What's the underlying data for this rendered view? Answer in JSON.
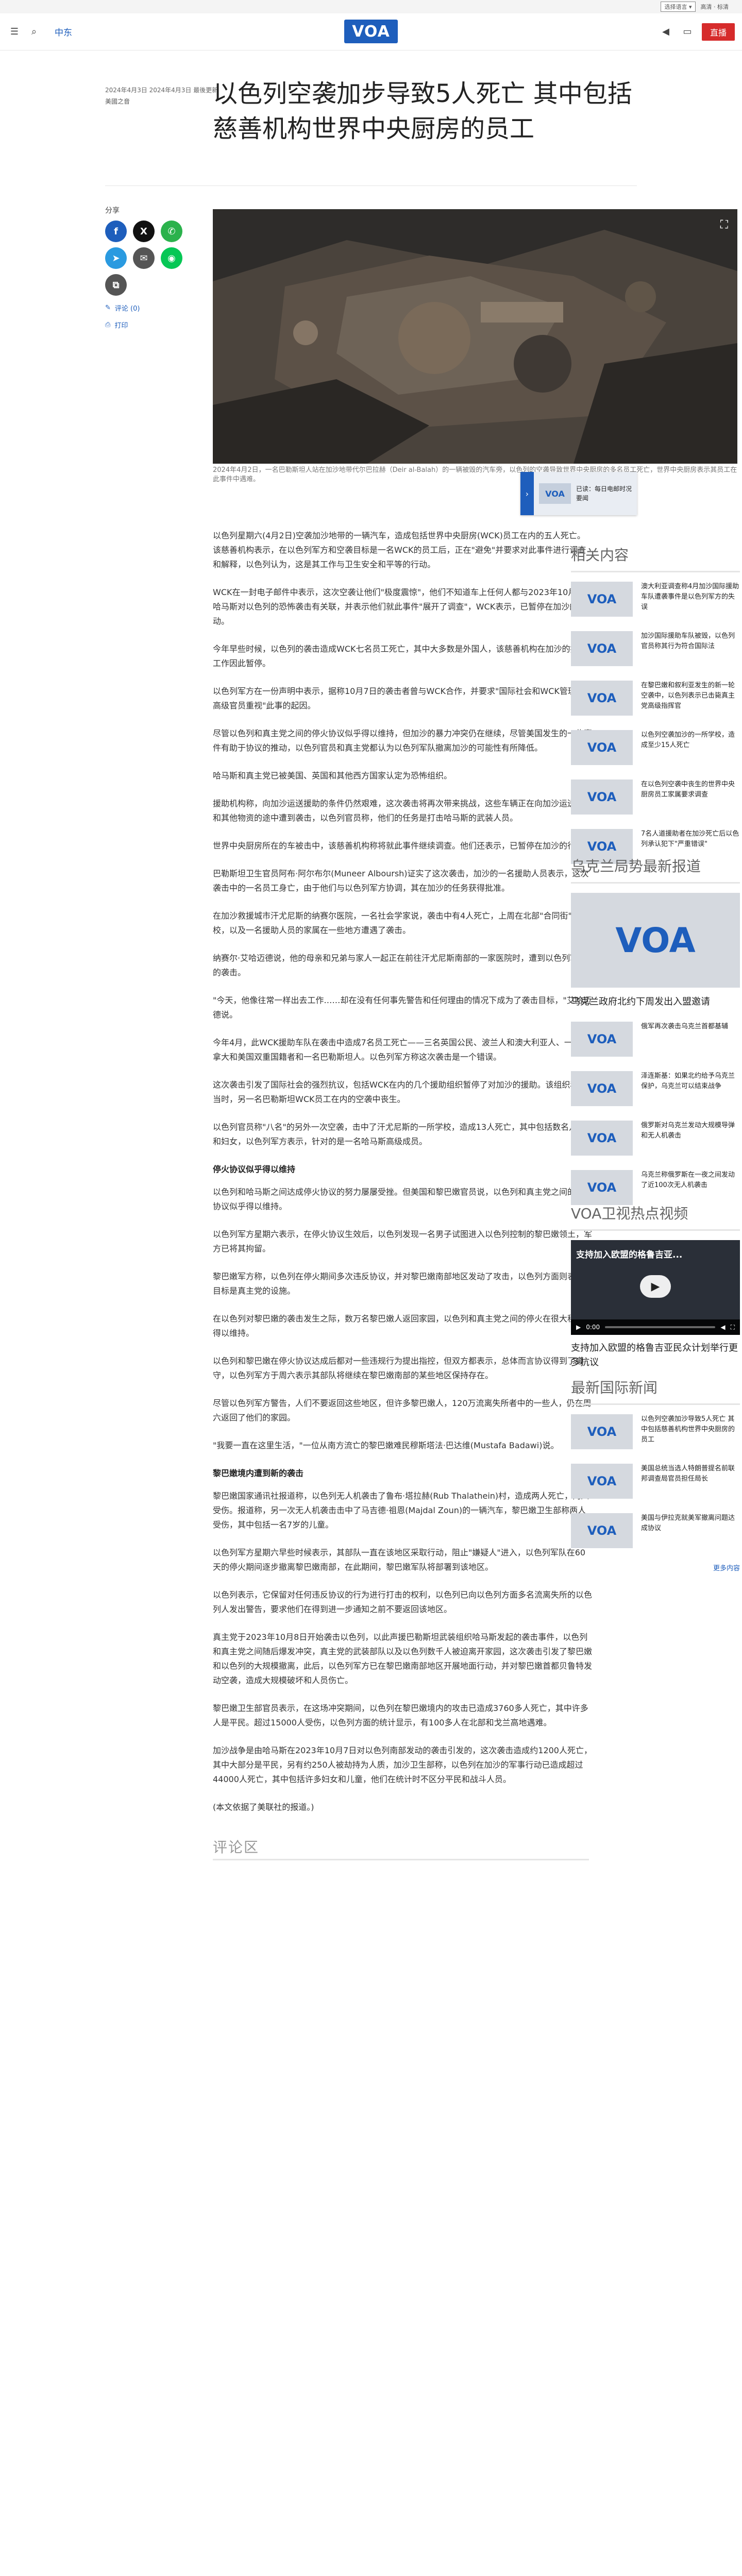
{
  "topbar": {
    "lang_select": "选择语言 ▾",
    "hd": "高清 · 标清"
  },
  "header": {
    "section": "中东",
    "logo": "VOA",
    "live": "直播"
  },
  "meta": {
    "dates": "2024年4月3日 2024年4月3日 最後更新",
    "source": "美國之音"
  },
  "title": "以色列空袭加步导致5人死亡 其中包括慈善机构世界中央厨房的员工",
  "share": {
    "label": "分享",
    "comments": "评论 (0)",
    "print": "打印"
  },
  "hero": {
    "caption": "2024年4月2日，一名巴勒斯坦人站在加沙地带代尔巴拉赫（Deir al-Balah）的一辆被毁的汽车旁，以色列的空袭导致世界中央厨房的多名员工死亡，世界中央厨房表示其员工在此事件中遇难。"
  },
  "floatcard": {
    "text": "已读：每日电邮时况要闻"
  },
  "article": [
    {
      "type": "p",
      "text": "以色列星期六(4月2日)空袭加沙地带的一辆汽车，造成包括世界中央厨房(WCK)员工在内的五人死亡。该慈善机构表示，在以色列军方和空袭目标是一名WCK的员工后，正在\"避免\"并要求对此事件进行调查和解释，以色列认为，这是其工作与卫生安全和平等的行动。"
    },
    {
      "type": "p",
      "text": "WCK在一封电子邮件中表示，这次空袭让他们\"极度震惊\"，他们不知道车上任何人都与2023年10月7日哈马斯对以色列的恐怖袭击有关联，并表示他们就此事件\"展开了调查\"，WCK表示，已暂停在加沙的行动。"
    },
    {
      "type": "p",
      "text": "今年早些时候，以色列的袭击造成WCK七名员工死亡，其中大多数是外国人，该慈善机构在加沙的援助工作因此暂停。"
    },
    {
      "type": "p",
      "text": "以色列军方在一份声明中表示，据称10月7日的袭击者曾与WCK合作，并要求\"国际社会和WCK管理层的高级官员重视\"此事的起因。"
    },
    {
      "type": "p",
      "text": "尽管以色列和真主党之间的停火协议似乎得以维持，但加沙的暴力冲突仍在继续，尽管美国发生的一些事件有助于协议的推动，以色列官员和真主党都认为以色列军队撤离加沙的可能性有所降低。"
    },
    {
      "type": "p",
      "text": "哈马斯和真主党已被美国、英国和其他西方国家认定为恐怖组织。"
    },
    {
      "type": "p",
      "text": "援助机构称，向加沙运送援助的条件仍然艰难，这次袭击将再次带来挑战，这些车辆正在向加沙运送食物和其他物资的途中遭到袭击，以色列官员称，他们的任务是打击哈马斯的武装人员。"
    },
    {
      "type": "p",
      "text": "世界中央厨房所在的车被击中，该慈善机构称将就此事件继续调查。他们还表示，已暂停在加沙的行动。"
    },
    {
      "type": "p",
      "text": "巴勒斯坦卫生官员阿布·阿尔布尔(Muneer Alboursh)证实了这次袭击，加沙的一名援助人员表示，这次袭击中的一名员工身亡，由于他们与以色列军方协调，其在加沙的任务获得批准。"
    },
    {
      "type": "p",
      "text": "在加沙救援城市汗尤尼斯的纳赛尔医院，一名社会学家说，袭击中有4人死亡，上周在北部\"合同街\"学校，以及一名援助人员的家属在一些地方遭遇了袭击。"
    },
    {
      "type": "p",
      "text": "纳赛尔·艾哈迈德说，他的母亲和兄弟与家人一起正在前往汗尤尼斯南部的一家医院时，遭到以色列军队的袭击。"
    },
    {
      "type": "p",
      "text": "\"今天，他像往常一样出去工作……却在没有任何事先警告和任何理由的情况下成为了袭击目标，\"艾哈迈德说。"
    },
    {
      "type": "p",
      "text": "今年4月，此WCK援助车队在袭击中造成7名员工死亡——三名英国公民、波兰人和澳大利亚人、一名加拿大和美国双重国籍者和一名巴勒斯坦人。以色列军方称这次袭击是一个错误。"
    },
    {
      "type": "p",
      "text": "这次袭击引发了国际社会的强烈抗议，包括WCK在内的几个援助组织暂停了对加沙的援助。该组织称，当时，另一名巴勒斯坦WCK员工在内的空袭中丧生。"
    },
    {
      "type": "p",
      "text": "以色列官员称\"八名\"的另外一次空袭，击中了汗尤尼斯的一所学校，造成13人死亡，其中包括数名儿童和妇女，以色列军方表示，针对的是一名哈马斯高级成员。"
    },
    {
      "type": "h",
      "text": "停火协议似乎得以维持"
    },
    {
      "type": "p",
      "text": "以色列和哈马斯之间达成停火协议的努力屡屡受挫。但美国和黎巴嫩官员说，以色列和真主党之间的停火协议似乎得以维持。"
    },
    {
      "type": "p",
      "text": "以色列军方星期六表示，在停火协议生效后，以色列发现一名男子试图进入以色列控制的黎巴嫩领土，军方已将其拘留。"
    },
    {
      "type": "p",
      "text": "黎巴嫩军方称，以色列在停火期间多次违反协议，并对黎巴嫩南部地区发动了攻击，以色列方面则表示其目标是真主党的设施。"
    },
    {
      "type": "p",
      "text": "在以色列对黎巴嫩的袭击发生之际，数万名黎巴嫩人返回家园，以色列和真主党之间的停火在很大程度上得以维持。"
    },
    {
      "type": "p",
      "text": "以色列和黎巴嫩在停火协议达成后都对一些违规行为提出指控，但双方都表示，总体而言协议得到了遵守，以色列军方于周六表示其部队将继续在黎巴嫩南部的某些地区保持存在。"
    },
    {
      "type": "p",
      "text": "尽管以色列军方警告，人们不要返回这些地区，但许多黎巴嫩人，120万流离失所者中的一些人，仍在周六返回了他们的家园。"
    },
    {
      "type": "p",
      "text": "\"我要一直在这里生活，\"一位从南方流亡的黎巴嫩难民穆斯塔法·巴达维(Mustafa Badawi)说。"
    },
    {
      "type": "h",
      "text": "黎巴嫩境内遭到新的袭击"
    },
    {
      "type": "p",
      "text": "黎巴嫩国家通讯社报道称，以色列无人机袭击了鲁布·塔拉赫(Rub Thalathein)村，造成两人死亡，两人受伤。报道称，另一次无人机袭击击中了马吉德·祖恩(Majdal Zoun)的一辆汽车，黎巴嫩卫生部称两人受伤，其中包括一名7岁的儿童。"
    },
    {
      "type": "p",
      "text": "以色列军方星期六早些时候表示，其部队一直在该地区采取行动，阻止\"嫌疑人\"进入，以色列军队在60天的停火期间逐步撤离黎巴嫩南部，在此期间，黎巴嫩军队将部署到该地区。"
    },
    {
      "type": "p",
      "text": "以色列表示，它保留对任何违反协议的行为进行打击的权利，以色列已向以色列方面多名流离失所的以色列人发出警告，要求他们在得到进一步通知之前不要返回该地区。"
    },
    {
      "type": "p",
      "text": "真主党于2023年10月8日开始袭击以色列，以此声援巴勒斯坦武装组织哈马斯发起的袭击事件，以色列和真主党之间随后爆发冲突，真主党的武装部队以及以色列数千人被迫离开家园，这次袭击引发了黎巴嫩和以色列的大规模撤离，此后，以色列军方已在黎巴嫩南部地区开展地面行动，并对黎巴嫩首都贝鲁特发动空袭，造成大规模破坏和人员伤亡。"
    },
    {
      "type": "p",
      "text": "黎巴嫩卫生部官员表示，在这场冲突期间，以色列在黎巴嫩境内的攻击已造成3760多人死亡，其中许多人是平民。超过15000人受伤，以色列方面的统计显示，有100多人在北部和戈兰高地遇难。"
    },
    {
      "type": "p",
      "text": "加沙战争是由哈马斯在2023年10月7日对以色列南部发动的袭击引发的，这次袭击造成约1200人死亡，其中大部分是平民，另有约250人被劫持为人质，加沙卫生部称，以色列在加沙的军事行动已造成超过44000人死亡，其中包括许多妇女和儿童，他们在统计时不区分平民和战斗人员。"
    },
    {
      "type": "p",
      "text": "(本文依据了美联社的报道。)"
    }
  ],
  "comments_heading": "评论区",
  "sidebar": {
    "related_h": "相关内容",
    "related": [
      "澳大利亚调查称4月加沙国际援助车队遭袭事件是以色列军方的失误",
      "加沙国际援助车队被毁，以色列官员称其行为符合国际法",
      "在黎巴嫩和叙利亚发生的新一轮空袭中，以色列表示已击毙真主党高级指挥官",
      "以色列空袭加沙的一所学校，造成至少15人死亡",
      "在以色列空袭中丧生的世界中央厨房员工家属要求调查",
      "7名人道援助者在加沙死亡后以色列承认犯下\"严重错误\""
    ],
    "voa_h": "乌克兰局势最新报道",
    "voa_big": "乌克兰政府北约下周发出入盟邀请",
    "voa_list": [
      "俄军再次袭击乌克兰首都基辅",
      "泽连斯基：如果北约给予乌克兰保护，乌克兰可以结束战争",
      "俄罗斯对乌克兰发动大规模导弹和无人机袭击",
      "乌克兰称俄罗斯在一夜之间发动了近100次无人机袭击"
    ],
    "video_h": "VOA卫视热点视频",
    "video_title": "支持加入欧盟的格鲁吉亚...",
    "video_time": "0:00",
    "video_caption": "支持加入欧盟的格鲁吉亚民众计划举行更多抗议",
    "latest_h": "最新国际新闻",
    "latest": [
      "以色列空袭加沙导致5人死亡 其中包括慈善机构世界中央厨房的员工",
      "美国总统当选人特朗普提名前联邦调查局官员担任局长",
      "美国与伊拉克就美军撤离问题达成协议"
    ],
    "more": "更多内容"
  }
}
